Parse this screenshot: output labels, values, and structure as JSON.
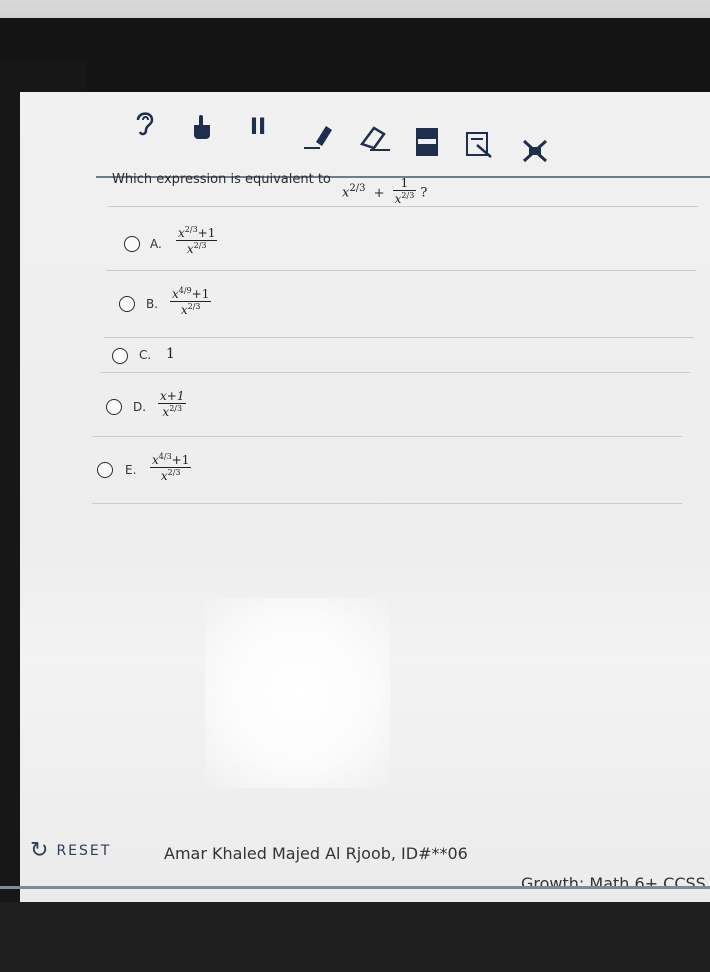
{
  "toolbar": {
    "icons": [
      "ear-icon",
      "hand-pointer-icon",
      "pause-icon",
      "highlighter-icon",
      "eraser-icon",
      "line-reader-icon",
      "answer-masking-icon",
      "answer-eliminator-icon"
    ],
    "pause_glyph": "II"
  },
  "question": {
    "text": "Which expression is equivalent to",
    "term1_base": "x",
    "term1_exp": "2/3",
    "plus": "+",
    "frac_num": "1",
    "frac_den_base": "x",
    "frac_den_exp": "2/3",
    "qmark": "?"
  },
  "choices": [
    {
      "letter": "A.",
      "num_base": "x",
      "num_exp": "2/3",
      "num_tail": "+1",
      "den_base": "x",
      "den_exp": "2/3"
    },
    {
      "letter": "B.",
      "num_base": "x",
      "num_exp": "4/9",
      "num_tail": "+1",
      "den_base": "x",
      "den_exp": "2/3"
    },
    {
      "letter": "C.",
      "value": "1"
    },
    {
      "letter": "D.",
      "num_text": "x+1",
      "den_base": "x",
      "den_exp": "2/3"
    },
    {
      "letter": "E.",
      "num_base": "x",
      "num_exp": "4/3",
      "num_tail": "+1",
      "den_base": "x",
      "den_exp": "2/3"
    }
  ],
  "footer": {
    "reset_label": "RESET",
    "student": "Amar Khaled Majed Al Rjoob, ID#**06",
    "test": "Growth: Math 6+ CCSS"
  }
}
